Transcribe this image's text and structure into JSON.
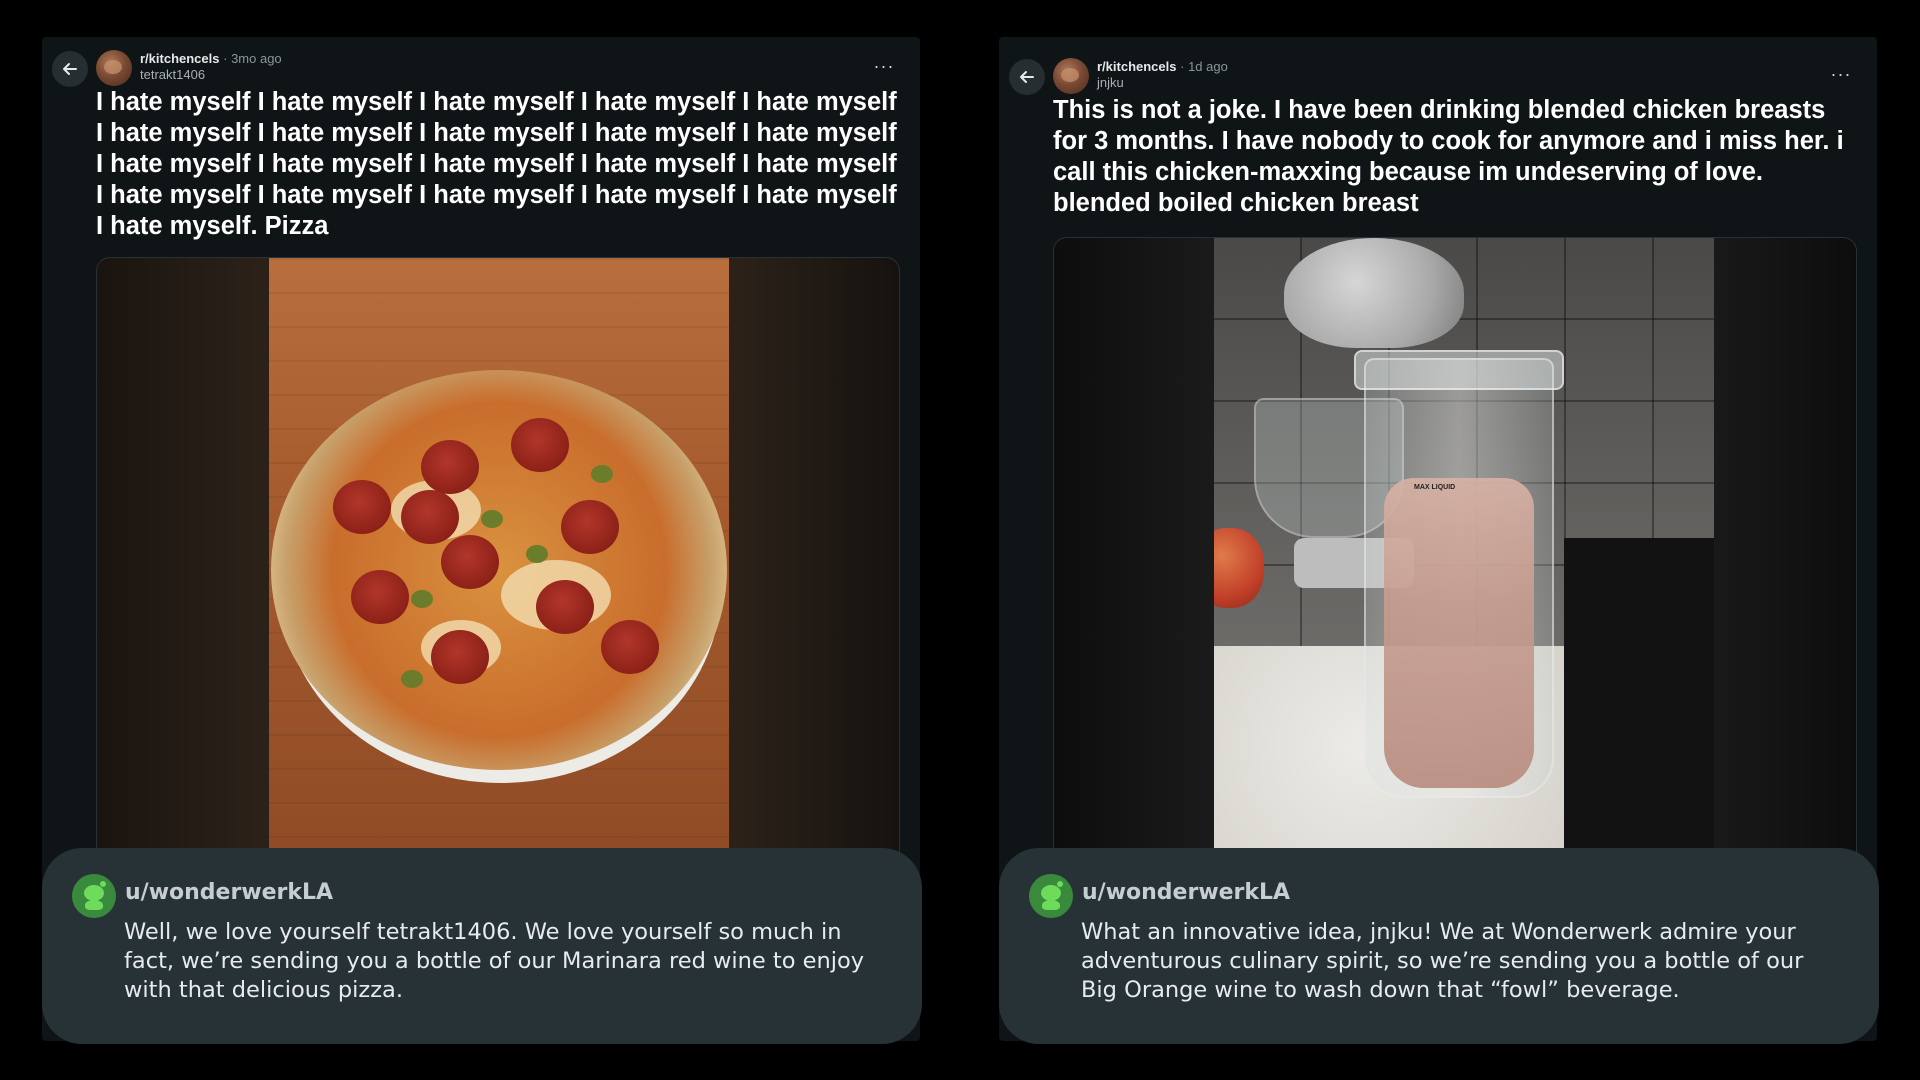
{
  "left_post": {
    "subreddit": "r/kitchencels",
    "time": "· 3mo ago",
    "author": "tetrakt1406",
    "title": "I hate myself I hate myself I hate myself I hate myself I hate myself I hate myself I hate myself I hate myself I hate myself I hate myself I hate myself I hate myself I hate myself I hate myself I hate myself I hate myself I hate myself I hate myself I hate myself I hate myself I hate myself. Pizza",
    "more": "···"
  },
  "right_post": {
    "subreddit": "r/kitchencels",
    "time": "· 1d ago",
    "author": "jnjku",
    "title": "This is not a joke. I have been drinking blended chicken breasts for 3 months. I have nobody to cook for anymore and i miss her. i call this chicken-maxxing because im undeserving of love. blended boiled chicken breast",
    "more": "···",
    "gauge_label": "MAX LIQUID"
  },
  "left_comment": {
    "user": "u/wonderwerkLA",
    "text": "Well, we love yourself tetrakt1406. We love yourself so much in fact, we’re sending you a bottle of our Marinara red wine to enjoy with that delicious pizza."
  },
  "right_comment": {
    "user": "u/wonderwerkLA",
    "text": "What an innovative idea, jnjku! We at Wonderwerk admire your adventurous culinary spirit, so we’re sending you a bottle of our Big Orange wine to wash down that “fowl” beverage."
  },
  "icons": {
    "back": "arrow-left-icon",
    "more": "ellipsis-icon",
    "avatar": "snoo-avatar-icon"
  }
}
